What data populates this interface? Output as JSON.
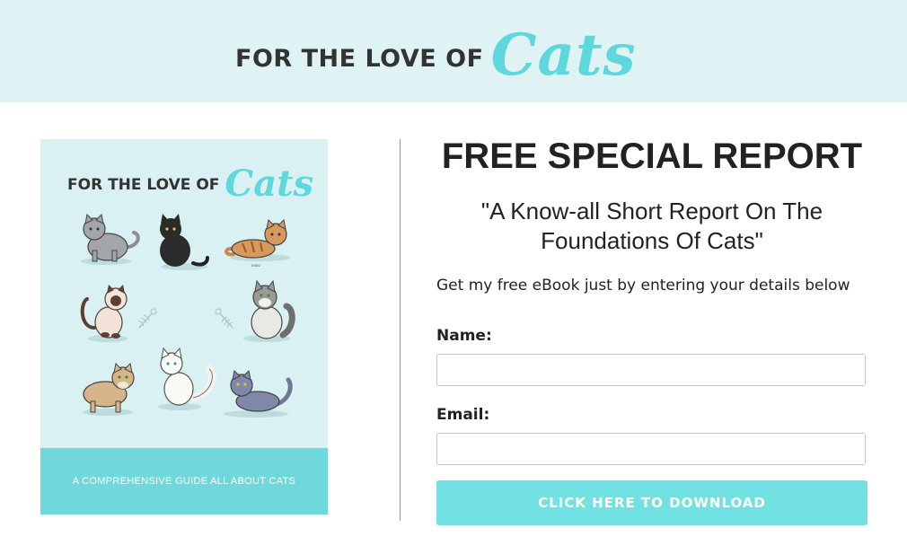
{
  "header": {
    "logo_prefix": "FOR THE LOVE OF",
    "logo_script": "Cats"
  },
  "cover": {
    "logo_prefix": "FOR THE LOVE OF",
    "logo_script": "Cats",
    "subtitle": "A COMPREHENSIVE GUIDE ALL ABOUT CATS",
    "tiny_caption": "oooo",
    "illustrations": [
      "grey-cat-icon",
      "black-cat-icon",
      "tabby-cat-icon",
      "siamese-cat-icon",
      "fish-bone-icon",
      "fish-bone-icon",
      "fluffy-grey-cat-icon",
      "tan-cat-icon",
      "white-fluffy-cat-icon",
      "blue-grey-cat-icon"
    ]
  },
  "main": {
    "title": "FREE SPECIAL REPORT",
    "subtitle": "\"A Know-all Short Report On The Foundations Of Cats\"",
    "intro": "Get my free eBook just by entering your details below"
  },
  "form": {
    "name_label": "Name:",
    "name_value": "",
    "email_label": "Email:",
    "email_value": "",
    "submit_label": "CLICK HERE TO DOWNLOAD"
  },
  "colors": {
    "header_bg": "#dff2f4",
    "accent": "#5ed8dc",
    "button": "#72e1e3",
    "cover_bg": "#d9f1f3",
    "cover_footer": "#6fd8dc"
  }
}
